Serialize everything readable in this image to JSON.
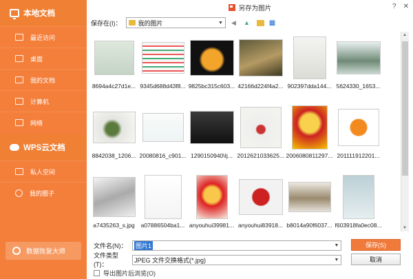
{
  "sidebar": {
    "local_title": "本地文档",
    "items": [
      {
        "label": "最近访问",
        "icon": "recent-icon"
      },
      {
        "label": "桌面",
        "icon": "desktop-icon"
      },
      {
        "label": "我的文档",
        "icon": "documents-icon"
      },
      {
        "label": "计算机",
        "icon": "computer-icon"
      },
      {
        "label": "网络",
        "icon": "network-icon"
      }
    ],
    "cloud_title": "WPS云文档",
    "cloud_items": [
      {
        "label": "私人空间",
        "icon": "person-icon"
      },
      {
        "label": "我的圈子",
        "icon": "circle-icon"
      }
    ],
    "recover_label": "数据恢复大师"
  },
  "window": {
    "title": "另存为图片",
    "help": "?",
    "close": "✕"
  },
  "location": {
    "label": "保存在(I)：",
    "value": "我的图片"
  },
  "files": [
    {
      "name": "8694a4c27d1e..."
    },
    {
      "name": "9345d688d43f8..."
    },
    {
      "name": "9825bc315c603..."
    },
    {
      "name": "42166d224f4a2..."
    },
    {
      "name": "902397dda144..."
    },
    {
      "name": "5624330_1653..."
    },
    {
      "name": "8842038_1206..."
    },
    {
      "name": "20080816_c901..."
    },
    {
      "name": "1290150940\\Ij..."
    },
    {
      "name": "2012621033625..."
    },
    {
      "name": "2006080811297..."
    },
    {
      "name": "201111912201..."
    },
    {
      "name": "a7435263_s.jpg"
    },
    {
      "name": "a07886504ba1..."
    },
    {
      "name": "anyouhui39981..."
    },
    {
      "name": "anyouhui83918..."
    },
    {
      "name": "b8014a90f6037..."
    },
    {
      "name": "f603918fa0ec08..."
    }
  ],
  "form": {
    "filename_label": "文件名(N)：",
    "filename_value": "图片1",
    "filetype_label": "文件类型(T)：",
    "filetype_value": "JPEG 文件交换格式(*.jpg)",
    "save_label": "保存(S)",
    "cancel_label": "取消",
    "browse_after_label": "导出图片后浏览(O)"
  },
  "colors": {
    "sidebar": "#f47f3b",
    "accent": "#f07a3a",
    "selection": "#3278d3"
  }
}
